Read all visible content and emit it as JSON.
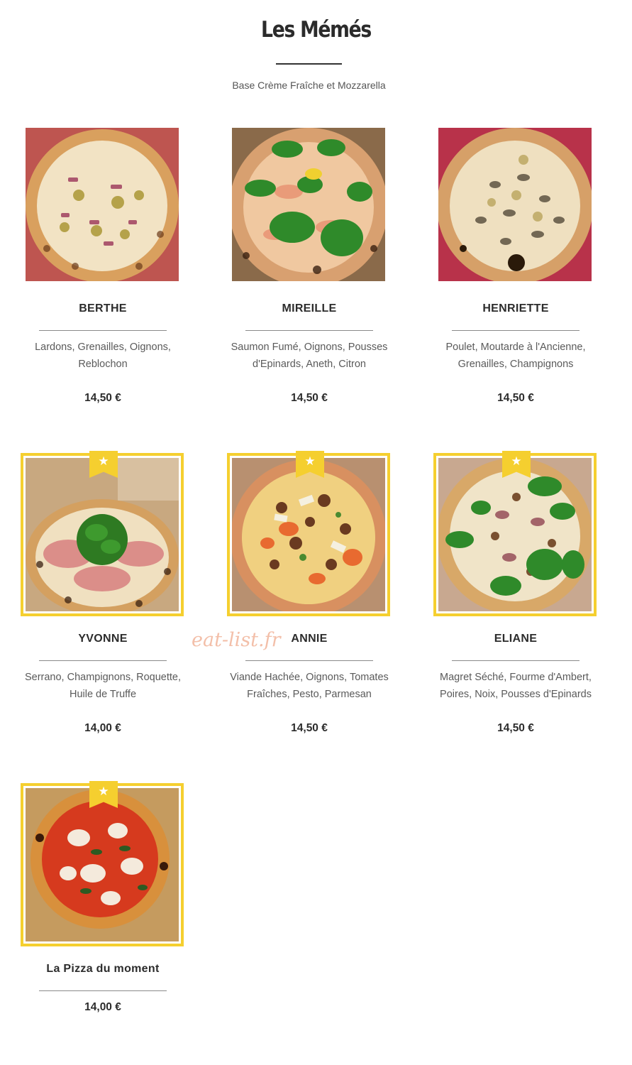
{
  "section": {
    "title": "Les Mémés",
    "subtitle": "Base Crème Fraîche et Mozzarella"
  },
  "watermark": "eat-list.fr",
  "colors": {
    "accent": "#f5cf2f",
    "text": "#2c2c2c",
    "muted": "#5a5a5a"
  },
  "pizzas": [
    {
      "name": "BERTHE",
      "description_line1": "Lardons, Grenailles, Oignons,",
      "description_line2": "Reblochon",
      "price": "14,50 €",
      "featured": false,
      "icon": "pizza-berthe-photo"
    },
    {
      "name": "MIREILLE",
      "description_line1": "Saumon Fumé, Oignons, Pousses",
      "description_line2": "d'Epinards, Aneth, Citron",
      "price": "14,50 €",
      "featured": false,
      "icon": "pizza-mireille-photo"
    },
    {
      "name": "HENRIETTE",
      "description_line1": "Poulet, Moutarde à l'Ancienne,",
      "description_line2": "Grenailles, Champignons",
      "price": "14,50 €",
      "featured": false,
      "icon": "pizza-henriette-photo"
    },
    {
      "name": "YVONNE",
      "description_line1": "Serrano, Champignons, Roquette,",
      "description_line2": "Huile de Truffe",
      "price": "14,00 €",
      "featured": true,
      "icon": "pizza-yvonne-photo"
    },
    {
      "name": "ANNIE",
      "description_line1": "Viande Hachée, Oignons, Tomates",
      "description_line2": "Fraîches, Pesto, Parmesan",
      "price": "14,50 €",
      "featured": true,
      "icon": "pizza-annie-photo"
    },
    {
      "name": "ELIANE",
      "description_line1": "Magret Séché, Fourme d'Ambert,",
      "description_line2": "Poires, Noix, Pousses d'Epinards",
      "price": "14,50 €",
      "featured": true,
      "icon": "pizza-eliane-photo"
    },
    {
      "name": "La Pizza du moment",
      "price": "14,00 €",
      "featured": true,
      "icon": "pizza-du-moment-photo"
    }
  ],
  "featured_badge": "★"
}
